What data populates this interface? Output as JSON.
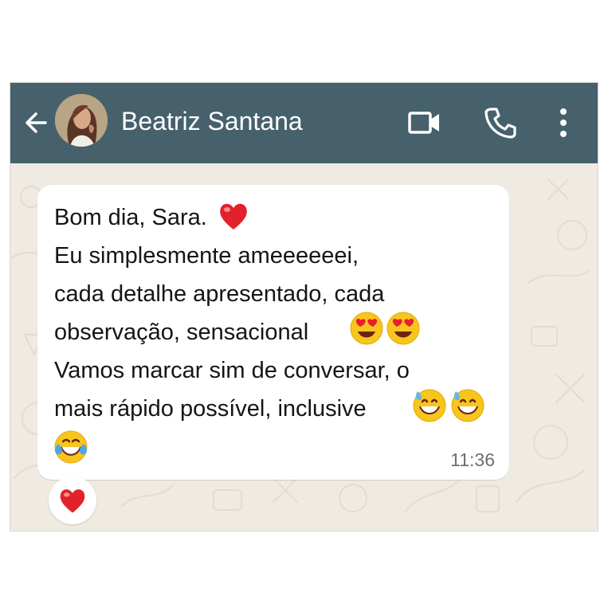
{
  "header": {
    "contact_name": "Beatriz Santana",
    "back_icon": "arrow-left-icon",
    "video_icon": "video-camera-icon",
    "call_icon": "phone-icon",
    "menu_icon": "more-vertical-icon"
  },
  "message": {
    "lines": [
      "Bom dia, Sara.",
      "Eu simplesmente ameeeeeei,",
      "cada detalhe apresentado, cada",
      "observação, sensacional",
      "Vamos marcar sim de conversar, o",
      "mais rápido possível, inclusive"
    ],
    "time": "11:36",
    "emojis": [
      "red-heart",
      "heart-eyes",
      "heart-eyes",
      "grinning-sweat",
      "grinning-sweat",
      "tears-of-joy"
    ]
  },
  "reaction": {
    "emoji": "red-heart"
  },
  "colors": {
    "appbar": "#46616b",
    "chat_background": "#efeae2",
    "bubble": "#ffffff",
    "text": "#151515",
    "timestamp": "#6b7075"
  }
}
